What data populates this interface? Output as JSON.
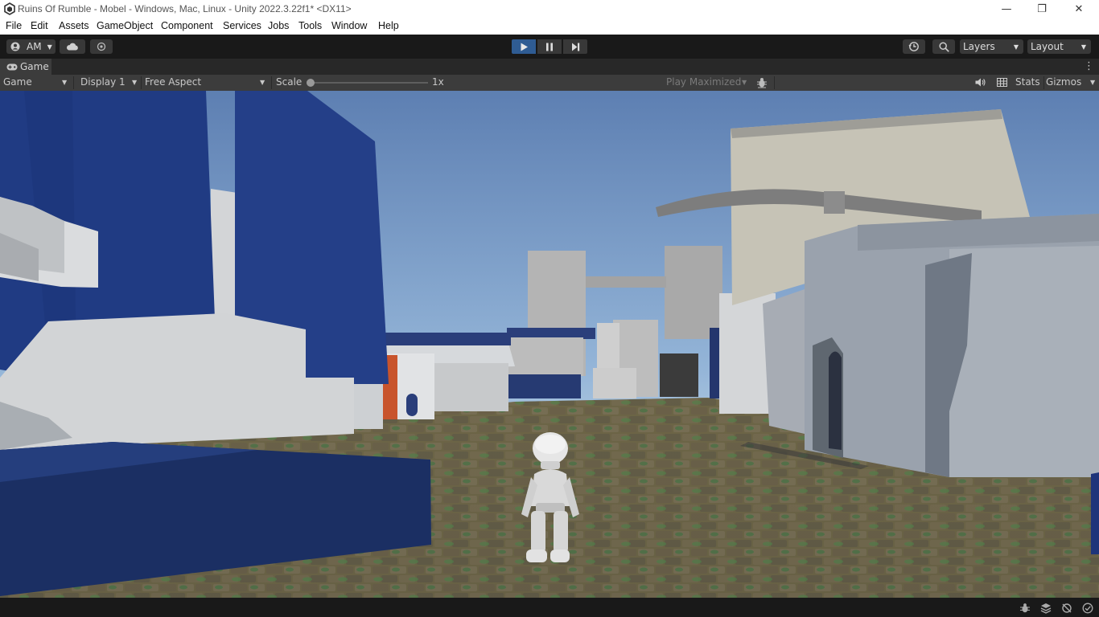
{
  "window": {
    "title": "Ruins Of Rumble - Mobel - Windows, Mac, Linux - Unity 2022.3.22f1* <DX11>",
    "minimize_glyph": "—",
    "restore_glyph": "❐",
    "close_glyph": "✕"
  },
  "menu": [
    "File",
    "Edit",
    "Assets",
    "GameObject",
    "Component",
    "Services",
    "Jobs",
    "Tools",
    "Window",
    "Help"
  ],
  "toolbar": {
    "account_label": "AM",
    "layers_label": "Layers",
    "layout_label": "Layout",
    "accent_color": "#3a7bd5"
  },
  "tab": {
    "label": "Game",
    "menu_glyph": "⋮"
  },
  "game_bar": {
    "view_mode": "Game",
    "display": "Display 1",
    "aspect": "Free Aspect",
    "scale_label": "Scale",
    "scale_value": "1x",
    "scale_fraction": 0.0,
    "play_mode": "Play Maximized",
    "stats_label": "Stats",
    "gizmos_label": "Gizmos"
  },
  "icons": {
    "unity_logo": "unity-logo-icon",
    "account": "account-icon",
    "cloud": "cloud-icon",
    "collab": "collab-icon",
    "play": "play-icon",
    "pause": "pause-icon",
    "step": "step-icon",
    "history": "history-icon",
    "search": "search-icon",
    "bug": "bug-icon",
    "audio": "audio-icon",
    "grid": "grid-icon",
    "status": [
      "debug-icon",
      "layers-status-icon",
      "dependency-icon",
      "check-icon"
    ]
  }
}
